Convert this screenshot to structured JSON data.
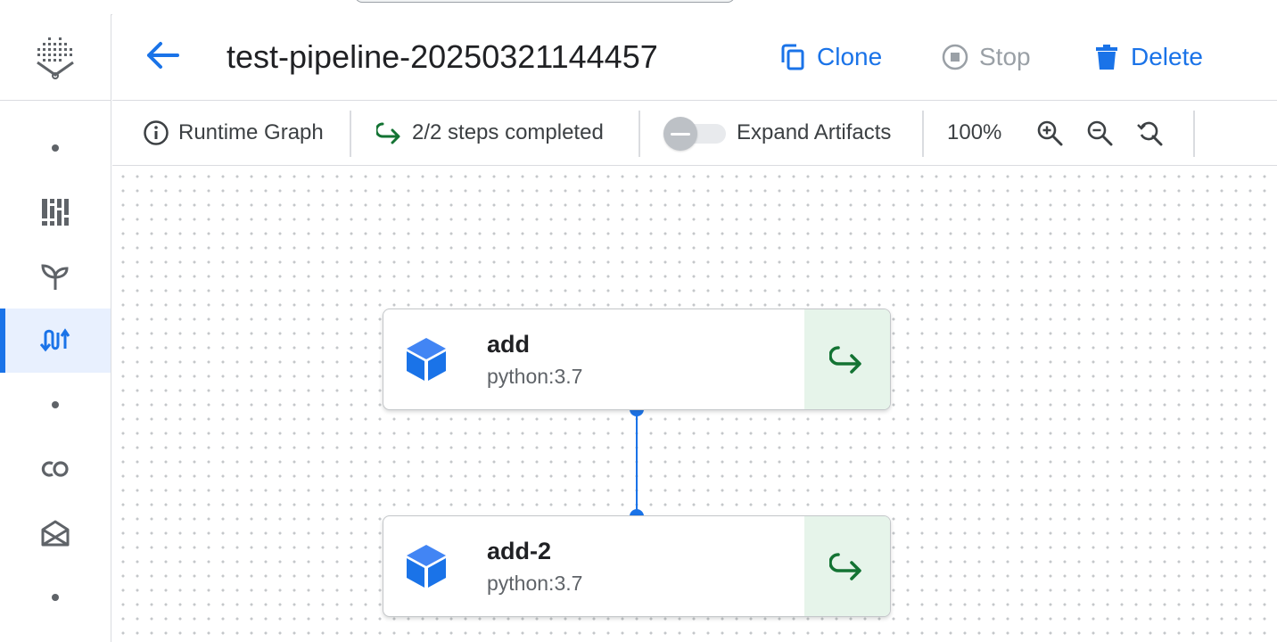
{
  "header": {
    "title": "test-pipeline-20250321144457",
    "clone_label": "Clone",
    "stop_label": "Stop",
    "delete_label": "Delete"
  },
  "toolbar": {
    "runtime_graph_label": "Runtime Graph",
    "steps_status": "2/2 steps completed",
    "expand_artifacts_label": "Expand Artifacts",
    "expand_artifacts_on": false,
    "zoom_level": "100%"
  },
  "sidebar": {
    "active_item": "runs"
  },
  "graph": {
    "nodes": [
      {
        "name": "add",
        "image": "python:3.7",
        "status": "succeeded"
      },
      {
        "name": "add-2",
        "image": "python:3.7",
        "status": "succeeded"
      }
    ],
    "edges": [
      {
        "from": "add",
        "to": "add-2"
      }
    ]
  },
  "colors": {
    "accent": "#1a73e8",
    "success": "#137333",
    "success_bg": "#e6f4ea",
    "disabled": "#9aa0a6"
  }
}
